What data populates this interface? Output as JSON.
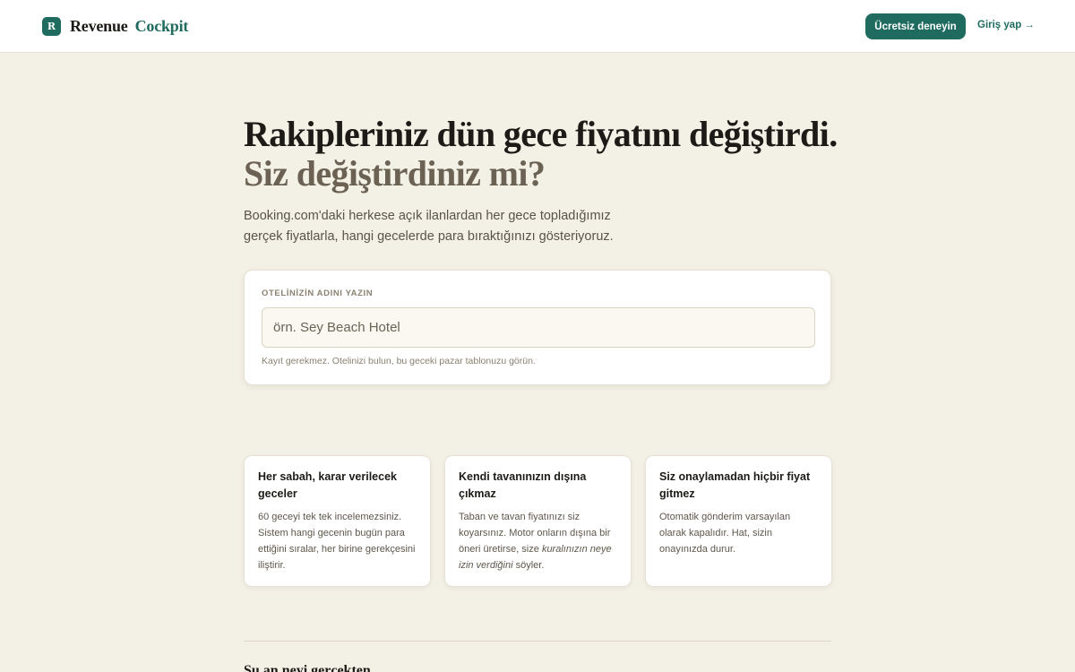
{
  "header": {
    "brand_mark": "R",
    "brand_name": "Revenue",
    "brand_accent": "Cockpit",
    "cta_label": "Ücretsiz deneyin",
    "login_label": "Giriş yap →"
  },
  "hero": {
    "title_line1": "Rakipleriniz dün gece fiyatını değiştirdi.",
    "title_line2": "Siz değiştirdiniz mi?",
    "subtitle": "Booking.com'daki herkese açık ilanlardan her gece topladığımız gerçek fiyatlarla, hangi gecelerde para bıraktığınızı gösteriyoruz."
  },
  "search": {
    "label": "OTELİNİZİN ADINI YAZIN",
    "value": "",
    "placeholder": "örn. Sey Beach Hotel",
    "hint": "Kayıt gerekmez. Otelinizi bulun, bu geceki pazar tablonuzu görün."
  },
  "features": [
    {
      "title": "Her sabah, karar verilecek geceler",
      "body": "60 geceyi tek tek incelemezsiniz. Sistem hangi gecenin bugün para ettiğini sıralar, her birine gerekçesini iliştirir."
    },
    {
      "title": "Kendi tavanınızın dışına çıkmaz",
      "body_before": "Taban ve tavan fiyatınızı siz koyarsınız. Motor onların dışına bir öneri üretirse, size ",
      "body_emphasis": "kuralınızın neye izin verdiğini",
      "body_after": " söyler."
    },
    {
      "title": "Siz onaylamadan hiçbir fiyat gitmez",
      "body": "Otomatik gönderim varsayılan olarak kapalıdır. Hat, sizin onayınızda durur."
    }
  ],
  "next_section": {
    "heading": "Şu an neyi gerçekten"
  },
  "colors": {
    "brand": "#1f6b5f",
    "background": "#f3f0e6",
    "card": "#ffffff",
    "title_muted": "#6b6253"
  }
}
